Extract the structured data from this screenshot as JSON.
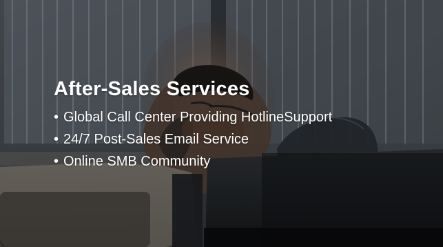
{
  "slide": {
    "title": "After-Sales Services",
    "bullets": [
      {
        "marker": "•",
        "label": "Global Call Center Providing HotlineSupport"
      },
      {
        "marker": "•",
        "label": "24/7 Post-Sales Email Service"
      },
      {
        "marker": "•",
        "label": "Online SMB Community"
      }
    ]
  },
  "colors": {
    "background_dark": "#2f3338",
    "text": "#ffffff"
  }
}
